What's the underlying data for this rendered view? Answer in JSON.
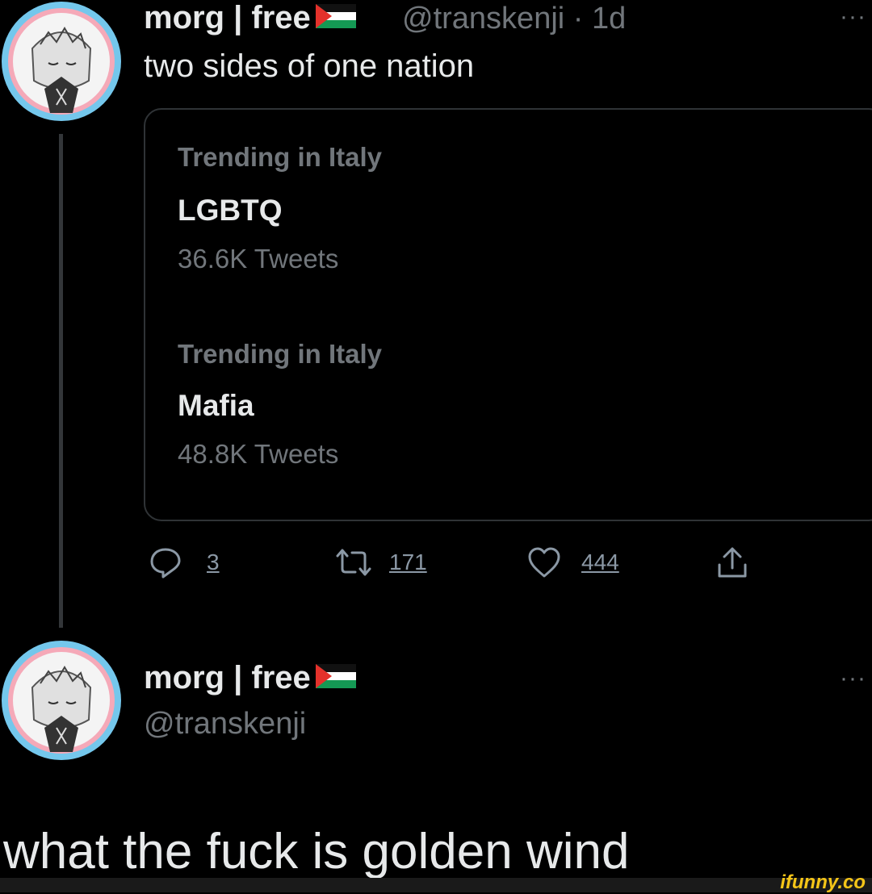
{
  "tweet1": {
    "display_name": "morg | free",
    "handle_time": "@transkenji · 1d",
    "more_label": "···",
    "text": "two sides of one nation",
    "trend_card": {
      "trends": [
        {
          "category": "Trending in Italy",
          "name": "LGBTQ",
          "count": "36.6K Tweets"
        },
        {
          "category": "Trending in Italy",
          "name": "Mafia",
          "count": "48.8K Tweets"
        }
      ]
    },
    "actions": {
      "reply_icon": "reply-icon",
      "reply_count": "3",
      "retweet_icon": "retweet-icon",
      "retweet_count": "171",
      "like_icon": "heart-icon",
      "like_count": "444",
      "share_icon": "share-icon"
    }
  },
  "tweet2": {
    "display_name": "morg | free",
    "handle": "@transkenji",
    "more_label": "···"
  },
  "caption": "what the fuck is golden wind",
  "watermark": "ifunny.co",
  "colors": {
    "background": "#000000",
    "text": "#e7e9ea",
    "muted": "#71767b",
    "border": "#2f3336",
    "avatar_ring_blue": "#74c7ec",
    "avatar_ring_pink": "#f5a9b8",
    "watermark": "#f5c518"
  }
}
